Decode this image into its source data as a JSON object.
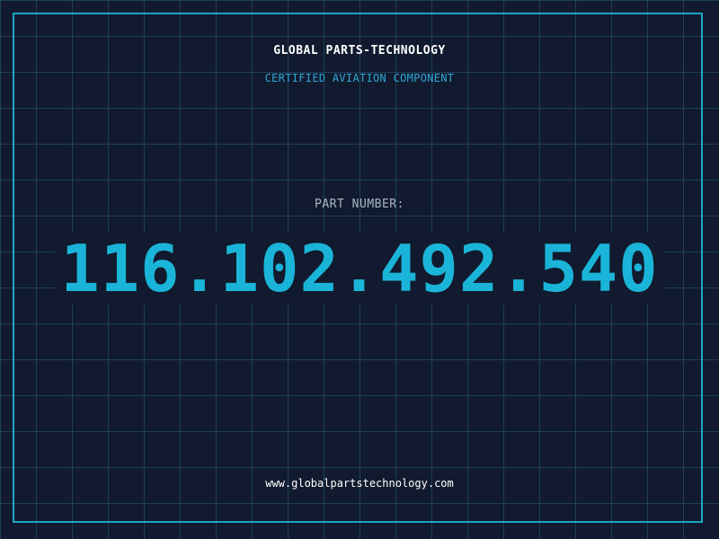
{
  "header": {
    "company_name": "GLOBAL PARTS-TECHNOLOGY",
    "tagline": "CERTIFIED AVIATION COMPONENT"
  },
  "part": {
    "label": "PART NUMBER:",
    "number": "116.102.492.540"
  },
  "footer": {
    "website": "www.globalpartstechnology.com"
  },
  "colors": {
    "background": "#111a2e",
    "grid_line": "#285f78",
    "frame_border": "#1aa6c9",
    "accent_cyan": "#1ab4d8",
    "tagline_blue": "#2fa8d6",
    "label_gray": "#aab7c8",
    "text_white": "#ffffff"
  }
}
